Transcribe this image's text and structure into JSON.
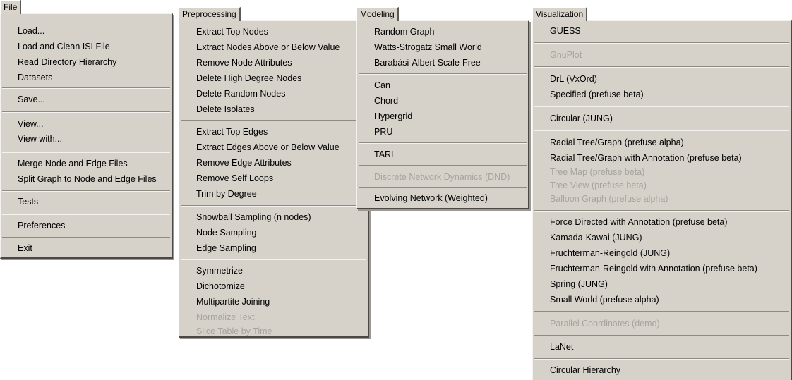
{
  "menus": {
    "file": {
      "title": "File",
      "items": [
        {
          "label": "Load...",
          "enabled": true
        },
        {
          "label": "Load and Clean ISI File",
          "enabled": true
        },
        {
          "label": "Read Directory Hierarchy",
          "enabled": true
        },
        {
          "label": "Datasets",
          "enabled": true
        },
        {
          "label": "Save...",
          "enabled": true
        },
        {
          "label": "View...",
          "enabled": true
        },
        {
          "label": "View with...",
          "enabled": true
        },
        {
          "label": "Merge Node and Edge Files",
          "enabled": true
        },
        {
          "label": "Split Graph to Node and Edge Files",
          "enabled": true
        },
        {
          "label": "Tests",
          "enabled": true
        },
        {
          "label": "Preferences",
          "enabled": true
        },
        {
          "label": "Exit",
          "enabled": true
        }
      ]
    },
    "preprocessing": {
      "title": "Preprocessing",
      "items": [
        {
          "label": "Extract Top Nodes",
          "enabled": true
        },
        {
          "label": "Extract Nodes Above or Below Value",
          "enabled": true
        },
        {
          "label": "Remove Node Attributes",
          "enabled": true
        },
        {
          "label": "Delete High Degree Nodes",
          "enabled": true
        },
        {
          "label": "Delete Random Nodes",
          "enabled": true
        },
        {
          "label": "Delete Isolates",
          "enabled": true
        },
        {
          "label": "Extract Top Edges",
          "enabled": true
        },
        {
          "label": "Extract Edges Above or Below Value",
          "enabled": true
        },
        {
          "label": "Remove Edge Attributes",
          "enabled": true
        },
        {
          "label": "Remove Self Loops",
          "enabled": true
        },
        {
          "label": "Trim by Degree",
          "enabled": true
        },
        {
          "label": "Snowball Sampling (n nodes)",
          "enabled": true
        },
        {
          "label": "Node Sampling",
          "enabled": true
        },
        {
          "label": "Edge Sampling",
          "enabled": true
        },
        {
          "label": "Symmetrize",
          "enabled": true
        },
        {
          "label": "Dichotomize",
          "enabled": true
        },
        {
          "label": "Multipartite Joining",
          "enabled": true
        },
        {
          "label": "Normalize Text",
          "enabled": false
        },
        {
          "label": "Slice Table by Time",
          "enabled": false
        }
      ]
    },
    "modeling": {
      "title": "Modeling",
      "items": [
        {
          "label": "Random Graph",
          "enabled": true
        },
        {
          "label": "Watts-Strogatz Small World",
          "enabled": true
        },
        {
          "label": "Barabási-Albert Scale-Free",
          "enabled": true
        },
        {
          "label": "Can",
          "enabled": true
        },
        {
          "label": "Chord",
          "enabled": true
        },
        {
          "label": "Hypergrid",
          "enabled": true
        },
        {
          "label": "PRU",
          "enabled": true
        },
        {
          "label": "TARL",
          "enabled": true
        },
        {
          "label": "Discrete Network Dynamics (DND)",
          "enabled": false
        },
        {
          "label": "Evolving Network (Weighted)",
          "enabled": true
        }
      ]
    },
    "visualization": {
      "title": "Visualization",
      "items": [
        {
          "label": "GUESS",
          "enabled": true
        },
        {
          "label": "GnuPlot",
          "enabled": false
        },
        {
          "label": "DrL (VxOrd)",
          "enabled": true
        },
        {
          "label": "Specified (prefuse beta)",
          "enabled": true
        },
        {
          "label": "Circular (JUNG)",
          "enabled": true
        },
        {
          "label": "Radial Tree/Graph (prefuse alpha)",
          "enabled": true
        },
        {
          "label": "Radial Tree/Graph with Annotation (prefuse beta)",
          "enabled": true
        },
        {
          "label": "Tree Map (prefuse beta)",
          "enabled": false
        },
        {
          "label": "Tree View (prefuse beta)",
          "enabled": false
        },
        {
          "label": "Balloon Graph (prefuse alpha)",
          "enabled": false
        },
        {
          "label": "Force Directed with Annotation (prefuse beta)",
          "enabled": true
        },
        {
          "label": "Kamada-Kawai (JUNG)",
          "enabled": true
        },
        {
          "label": "Fruchterman-Reingold (JUNG)",
          "enabled": true
        },
        {
          "label": "Fruchterman-Reingold with Annotation (prefuse beta)",
          "enabled": true
        },
        {
          "label": "Spring (JUNG)",
          "enabled": true
        },
        {
          "label": "Small World (prefuse alpha)",
          "enabled": true
        },
        {
          "label": "Parallel Coordinates (demo)",
          "enabled": false
        },
        {
          "label": "LaNet",
          "enabled": true
        },
        {
          "label": "Circular Hierarchy",
          "enabled": true
        }
      ]
    }
  }
}
